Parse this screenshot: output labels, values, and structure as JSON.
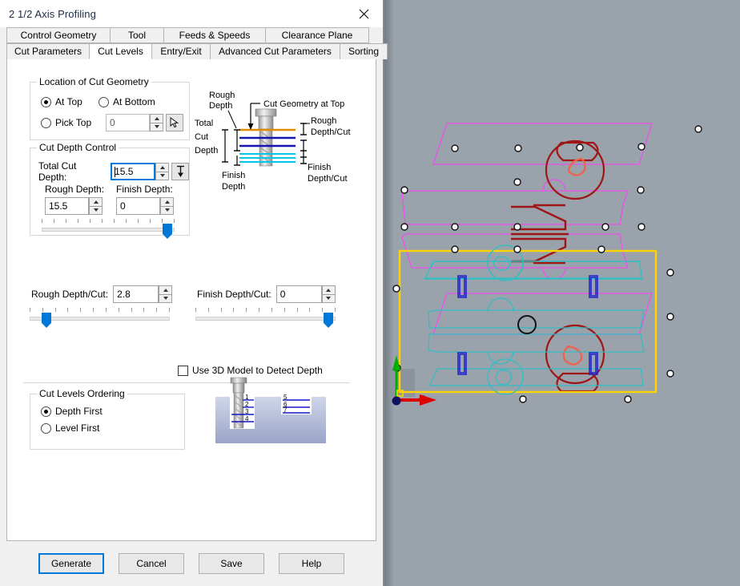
{
  "window": {
    "title": "2 1/2 Axis Profiling",
    "close_icon": "close-icon"
  },
  "tabs": {
    "row1": [
      {
        "label": "Control Geometry",
        "selected": false,
        "width": 130
      },
      {
        "label": "Tool",
        "selected": false,
        "width": 68
      },
      {
        "label": "Feeds & Speeds",
        "selected": false,
        "width": 128
      },
      {
        "label": "Clearance Plane",
        "selected": false,
        "width": 130
      }
    ],
    "row2": [
      {
        "label": "Cut Parameters",
        "selected": false,
        "width": 104
      },
      {
        "label": "Cut Levels",
        "selected": true,
        "width": 79
      },
      {
        "label": "Entry/Exit",
        "selected": false,
        "width": 74
      },
      {
        "label": "Advanced Cut Parameters",
        "selected": false,
        "width": 163
      },
      {
        "label": "Sorting",
        "selected": false,
        "width": 60
      }
    ]
  },
  "location_group": {
    "legend": "Location of Cut Geometry",
    "at_top": {
      "label": "At Top",
      "selected": true
    },
    "at_bottom": {
      "label": "At Bottom",
      "selected": false
    },
    "pick_top": {
      "label": "Pick Top",
      "selected": false
    },
    "pick_top_value": "0",
    "pick_top_enabled": false,
    "pick_icon": "pick-cursor-icon"
  },
  "cut_depth_group": {
    "legend": "Cut Depth Control",
    "total_cut_depth": {
      "label": "Total Cut Depth:",
      "value": "15.5"
    },
    "depth_icon": "depth-measure-icon",
    "rough_depth": {
      "label": "Rough Depth:",
      "value": "15.5"
    },
    "finish_depth": {
      "label": "Finish Depth:",
      "value": "0"
    },
    "depth_slider": {
      "position_pct": 98,
      "ticks": 12
    }
  },
  "per_cut": {
    "rough_depth_cut": {
      "label": "Rough Depth/Cut:",
      "value": "2.8"
    },
    "rough_slider": {
      "position_pct": 9,
      "ticks": 12
    },
    "finish_depth_cut": {
      "label": "Finish Depth/Cut:",
      "value": "0"
    },
    "finish_slider": {
      "position_pct": 98,
      "ticks": 12
    }
  },
  "use_3d_model": {
    "label": "Use 3D Model to Detect Depth",
    "checked": false
  },
  "ordering_group": {
    "legend": "Cut Levels Ordering",
    "depth_first": {
      "label": "Depth First",
      "selected": true
    },
    "level_first": {
      "label": "Level First",
      "selected": false
    }
  },
  "depth_diagram": {
    "cut_geometry_at_top": "Cut Geometry at Top",
    "rough_depth": [
      "Rough",
      "Depth"
    ],
    "total_cut_depth": [
      "Total",
      "Cut",
      "Depth"
    ],
    "finish_depth": [
      "Finish",
      "Depth"
    ],
    "rough_depth_cut": [
      "Rough",
      "Depth/Cut"
    ],
    "finish_depth_cut": [
      "Finish",
      "Depth/Cut"
    ]
  },
  "ordering_diagram": {
    "left_levels": [
      "1",
      "2",
      "3",
      "4"
    ],
    "right_levels": [
      "5",
      "6",
      "7"
    ]
  },
  "buttons": [
    {
      "label": "Generate",
      "default": true
    },
    {
      "label": "Cancel",
      "default": false
    },
    {
      "label": "Save",
      "default": false
    },
    {
      "label": "Help",
      "default": false
    }
  ],
  "viewport": {
    "background": "#9aa2ab",
    "selection_color": "#ffd400",
    "magenta_color": "#ee4fee",
    "darkred_color": "#9e1616",
    "salmon_color": "#f2624a",
    "cyan_color": "#2fbfc4",
    "blue_color": "#2222cc",
    "axis_x_color": "#e00000",
    "axis_y_color": "#00b000",
    "origin_color": "#101060"
  }
}
